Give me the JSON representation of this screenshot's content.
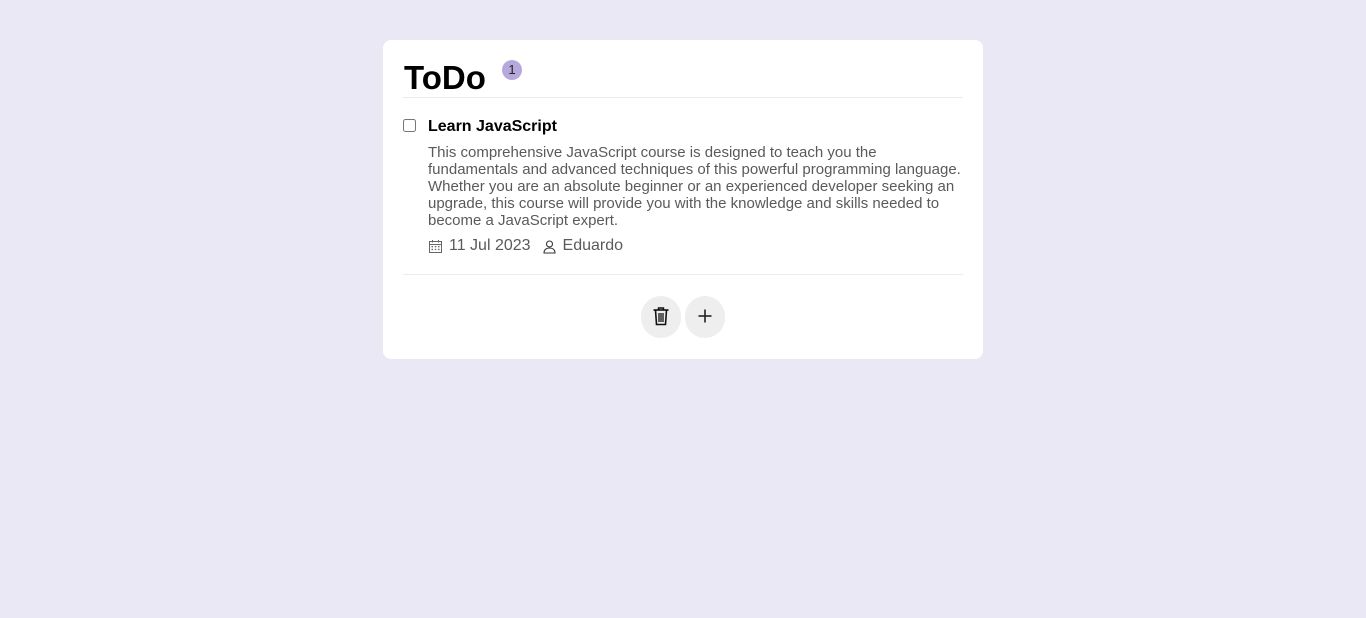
{
  "header": {
    "title": "ToDo",
    "count": "1"
  },
  "items": [
    {
      "title": "Learn JavaScript",
      "description": "This comprehensive JavaScript course is designed to teach you the fundamentals and advanced techniques of this powerful programming language. Whether you are an absolute beginner or an experienced developer seeking an upgrade, this course will provide you with the knowledge and skills needed to become a JavaScript expert.",
      "date": "11 Jul 2023",
      "author": "Eduardo",
      "checked": false
    }
  ],
  "actions": {
    "delete_icon": "trash-icon",
    "add_icon": "plus-icon"
  },
  "colors": {
    "background": "#eae8f5",
    "badge": "#b7a8dc"
  }
}
